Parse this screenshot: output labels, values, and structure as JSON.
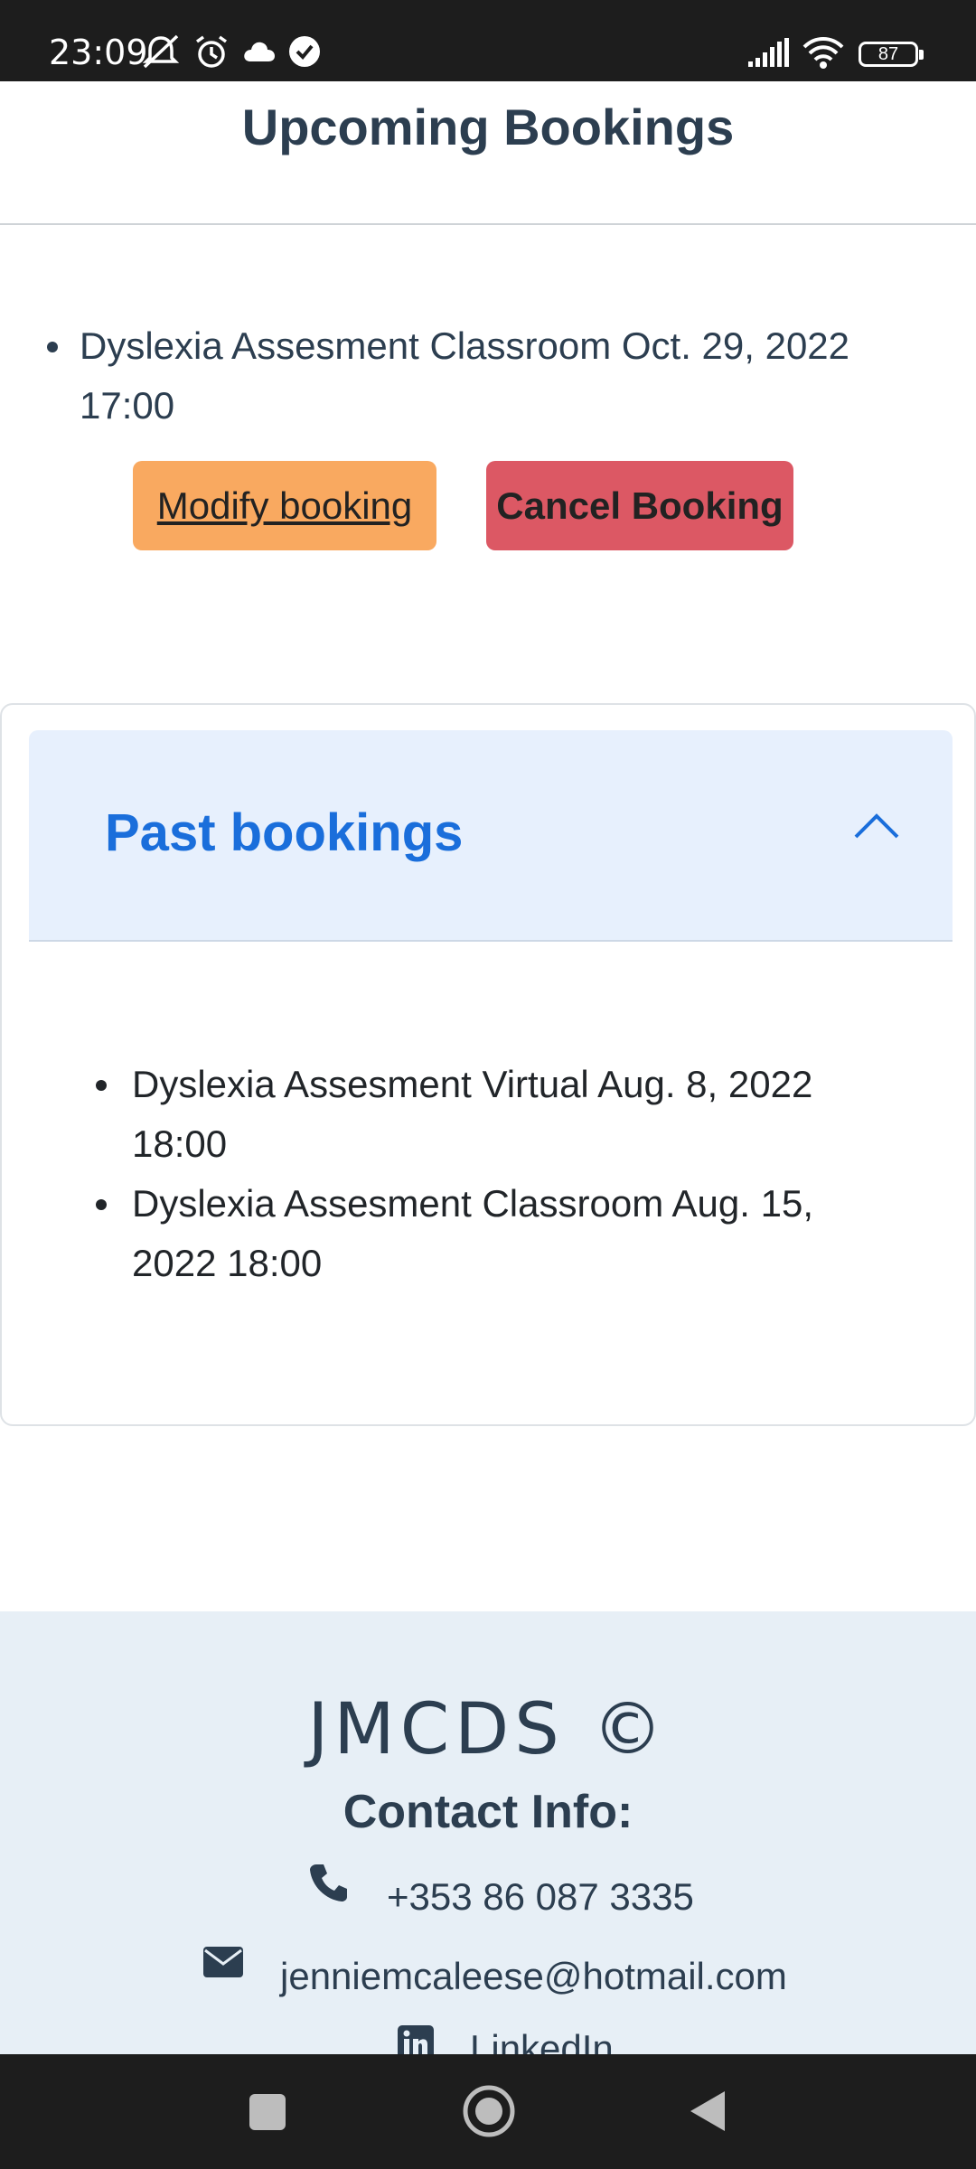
{
  "status_bar": {
    "time": "23:09",
    "battery": "87",
    "icons": [
      "mute-icon",
      "alarm-icon",
      "cloud-icon",
      "check-icon",
      "signal-icon",
      "wifi-icon",
      "battery-icon"
    ]
  },
  "upcoming": {
    "title": "Upcoming Bookings",
    "items": [
      {
        "line1": "Dyslexia Assesment Classroom Oct. 29, 2022",
        "line2": "17:00"
      }
    ],
    "modify_label": "Modify booking",
    "cancel_label": "Cancel Booking"
  },
  "past": {
    "title": "Past bookings",
    "expanded": true,
    "items": [
      {
        "line1": "Dyslexia Assesment Virtual Aug. 8, 2022",
        "line2": "18:00"
      },
      {
        "line1": "Dyslexia Assesment Classroom Aug. 15,",
        "line2": "2022 18:00"
      }
    ]
  },
  "footer": {
    "brand": "JMCDS ©",
    "contact_heading": "Contact Info:",
    "phone": "+353 86 087 3335",
    "email": "jenniemcaleese@hotmail.com",
    "linkedin": "LinkedIn"
  },
  "colors": {
    "accent_blue": "#1a6edb",
    "modify_orange": "#f9a960",
    "cancel_red": "#dc5864",
    "footer_bg": "#e7eff6"
  }
}
